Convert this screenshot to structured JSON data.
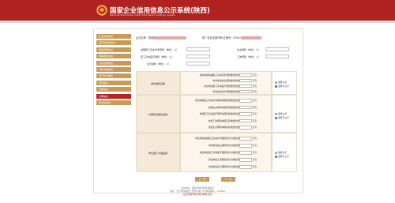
{
  "header": {
    "title": "国家企业信用信息公示系统",
    "province": "(陕西)",
    "subtitle": "National Enterprise Credit Information Publicity System"
  },
  "sidebar": {
    "items": [
      {
        "label": "企业基本信息",
        "active": false
      },
      {
        "label": "股东及出资信息",
        "active": false
      },
      {
        "label": "股权变更信息",
        "active": false
      },
      {
        "label": "网站网店信息",
        "active": false
      },
      {
        "label": "对外投资信息",
        "active": false
      },
      {
        "label": "对外担保信息",
        "active": false
      },
      {
        "label": "资产状况信息",
        "active": false
      },
      {
        "label": "党建信息",
        "active": false
      },
      {
        "label": "社保信息",
        "active": false
      },
      {
        "label": "社保信息",
        "active": true
      },
      {
        "label": "预览并提交",
        "active": false
      }
    ]
  },
  "info": {
    "company_label": "企业名称：",
    "company_value_prefix": "陕西",
    "credit_label": "统一社会信用代码/注册号：",
    "credit_value_prefix": "91610"
  },
  "fields": {
    "left": [
      {
        "label": "城镇职工基本养老保险（单位：人）"
      },
      {
        "label": "职工基本医疗保险（单位：人）"
      },
      {
        "label": "生育保险（单位：人）"
      }
    ],
    "right": [
      {
        "label": "失业保险（单位：人）"
      },
      {
        "label": "工伤保险（单位：人）"
      }
    ]
  },
  "sections": [
    {
      "title": "单位缴费基数",
      "rows": [
        {
          "label": "单位参加城镇职工基本养老保险缴费基数",
          "unit": "万元"
        },
        {
          "label": "单位参加失业保险缴费基数",
          "unit": "万元"
        },
        {
          "label": "单位参加职工基本医疗保险缴费基数",
          "unit": "万元"
        },
        {
          "label": "单位参加生育保险缴费基数",
          "unit": "万元"
        }
      ],
      "radios": [
        "选择公示",
        "选择不公示"
      ],
      "selected": 1
    },
    {
      "title": "本期实际缴费金额",
      "rows": [
        {
          "label": "参加城镇职工基本养老保险本期实际缴费金额",
          "unit": "万元"
        },
        {
          "label": "参加失业保险本期实际缴费金额",
          "unit": "万元"
        },
        {
          "label": "参加职工基本医疗保险本期实际缴费金额",
          "unit": "万元"
        },
        {
          "label": "参加工伤保险本期实际缴费金额",
          "unit": "万元"
        },
        {
          "label": "参加生育保险本期实际缴费金额",
          "unit": "万元"
        }
      ],
      "radios": [
        "选择公示",
        "选择不公示"
      ],
      "selected": 1
    },
    {
      "title": "单位累计欠缴金额",
      "rows": [
        {
          "label": "单位参加城镇职工基本养老保险累计欠缴金额",
          "unit": "万元"
        },
        {
          "label": "单位参加失业保险累计欠缴金额",
          "unit": "万元"
        },
        {
          "label": "单位参加职工基本医疗保险累计欠缴金额",
          "unit": "万元"
        },
        {
          "label": "单位参加工伤保险累计欠缴金额",
          "unit": "万元"
        },
        {
          "label": "单位参加生育保险累计欠缴金额",
          "unit": "万元"
        }
      ],
      "radios": [
        "选择公示",
        "选择不公示"
      ],
      "selected": 1
    }
  ],
  "buttons": {
    "prev": "上一步",
    "next": "下一步"
  },
  "footer": {
    "line1": "主办单位：国家市场监督管理总局",
    "line2": "地址：北京市西城区三里河东路八号 邮政编码：100820",
    "line3": "业务咨询与技术支持联系方式"
  },
  "colors": {
    "header": "#b0221f",
    "sidebar": "#c99a55",
    "sidebar_active": "#b8221f",
    "section_bg": "#f5e9d7"
  }
}
